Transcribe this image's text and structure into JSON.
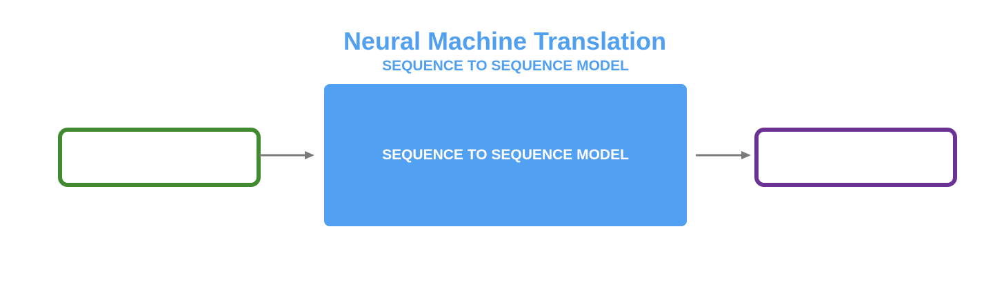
{
  "title": "Neural Machine Translation",
  "subtitle": "SEQUENCE TO SEQUENCE MODEL",
  "model": {
    "label": "SEQUENCE TO SEQUENCE MODEL",
    "color": "#52A0F2"
  },
  "input_box": {
    "text": "",
    "border_color": "#428A31"
  },
  "output_box": {
    "text": "",
    "border_color": "#6B3294"
  },
  "arrow_color": "#7A7A7A"
}
